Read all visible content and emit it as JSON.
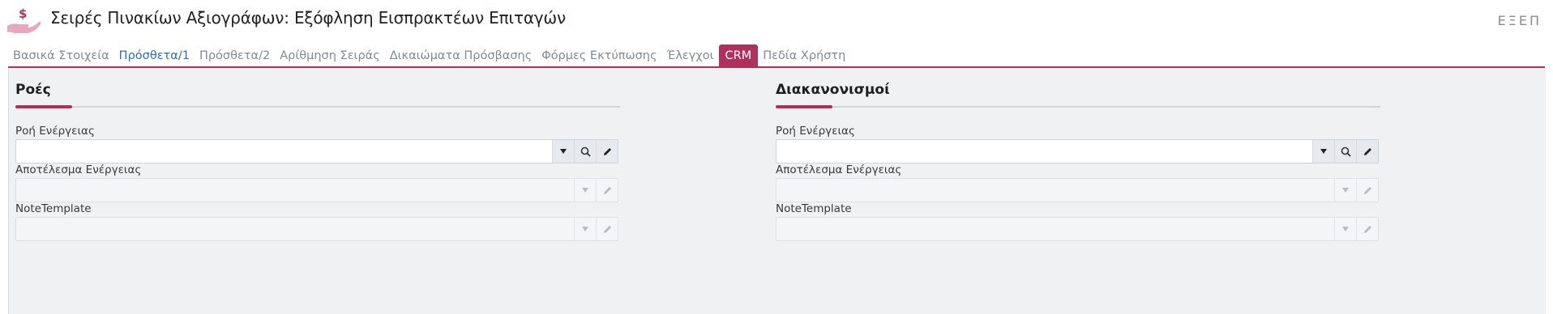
{
  "header": {
    "title": "Σειρές Πινακίων Αξιογράφων: Εξόφληση Εισπρακτέων Επιταγών",
    "window_controls": "ΕΞΕΠ",
    "app_icon": "hand-money-icon"
  },
  "tabs": [
    {
      "label": "Βασικά Στοιχεία",
      "state": "normal"
    },
    {
      "label": "Πρόσθετα/1",
      "state": "highlight"
    },
    {
      "label": "Πρόσθετα/2",
      "state": "normal"
    },
    {
      "label": "Αρίθμηση Σειράς",
      "state": "normal"
    },
    {
      "label": "Δικαιώματα Πρόσβασης",
      "state": "normal"
    },
    {
      "label": "Φόρμες Εκτύπωσης",
      "state": "normal"
    },
    {
      "label": "Έλεγχοι",
      "state": "normal"
    },
    {
      "label": "CRM",
      "state": "active"
    },
    {
      "label": "Πεδία Χρήστη",
      "state": "normal"
    }
  ],
  "sections": {
    "left": {
      "title": "Ροές",
      "fields": [
        {
          "label": "Ροή Ενέργειας",
          "value": "",
          "enabled": true
        },
        {
          "label": "Αποτέλεσμα Ενέργειας",
          "value": "",
          "enabled": false
        },
        {
          "label": "NoteTemplate",
          "value": "",
          "enabled": false
        }
      ]
    },
    "right": {
      "title": "Διακανονισμοί",
      "fields": [
        {
          "label": "Ροή Ενέργειας",
          "value": "",
          "enabled": true
        },
        {
          "label": "Αποτέλεσμα Ενέργειας",
          "value": "",
          "enabled": false
        },
        {
          "label": "NoteTemplate",
          "value": "",
          "enabled": false
        }
      ]
    }
  },
  "colors": {
    "accent": "#b0305c",
    "link": "#2a6cc2",
    "content_bg": "#eff1f3"
  }
}
